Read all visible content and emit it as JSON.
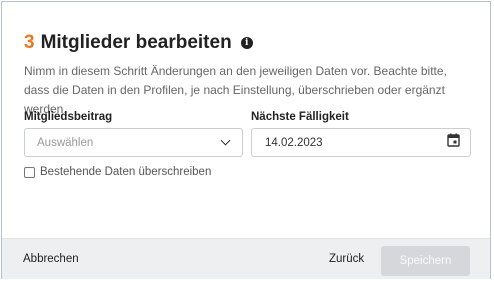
{
  "dialog": {
    "step_number": "3",
    "title": "Mitglieder bearbeiten",
    "info_icon": "i",
    "description": "Nimm in diesem Schritt Änderungen an den jeweiligen Daten vor. Beachte bitte, dass die Daten in den Profilen, je nach Einstellung, überschrieben oder ergänzt werden."
  },
  "form": {
    "membership_fee": {
      "label": "Mitgliedsbeitrag",
      "placeholder": "Auswählen",
      "selected_value": ""
    },
    "next_due": {
      "label": "Nächste Fälligkeit",
      "value": "14.02.2023"
    },
    "overwrite_checkbox": {
      "label": "Bestehende Daten überschreiben",
      "checked": false
    }
  },
  "footer": {
    "cancel_label": "Abbrechen",
    "back_label": "Zurück",
    "save_label": "Speichern"
  },
  "colors": {
    "accent": "#e8791e",
    "footer_bg": "#eeeff1",
    "disabled_button": "#d5d7db"
  },
  "icons": {
    "select": "chevron-down-icon",
    "date": "calendar-icon",
    "info": "info-icon"
  }
}
